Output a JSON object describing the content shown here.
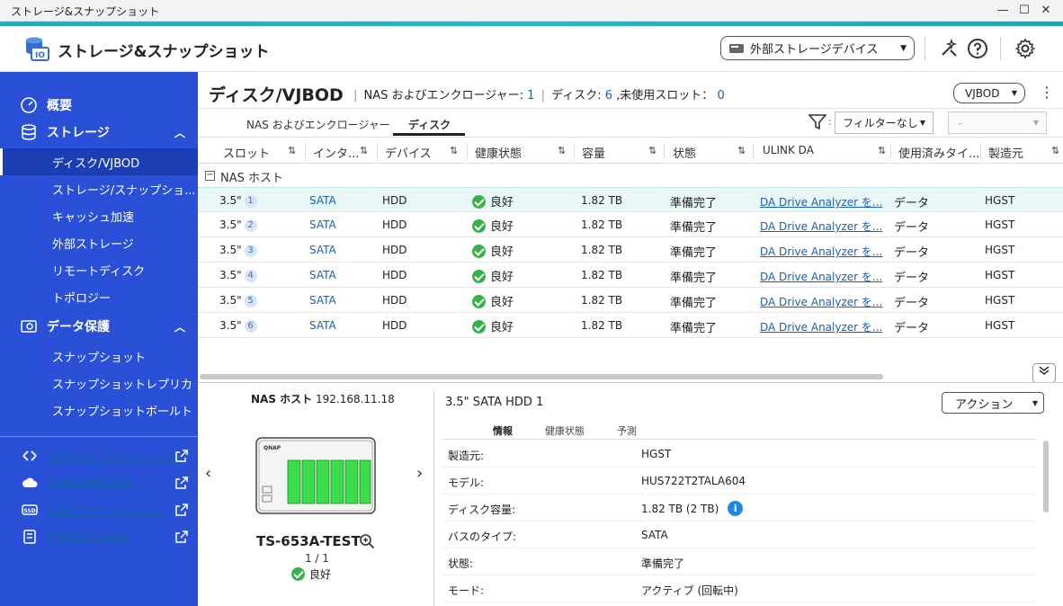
{
  "window": {
    "title": "ストレージ&スナップショット",
    "controls": [
      "—",
      "☐",
      "✕"
    ]
  },
  "app": {
    "title": "ストレージ&スナップショット",
    "external_device_label": "外部ストレージデバイス",
    "icons": [
      "wand-icon",
      "help-icon",
      "gear-icon"
    ]
  },
  "sidebar": {
    "overview": "概要",
    "storage": "ストレージ",
    "storage_items": [
      "ディスク/VJBOD",
      "ストレージ/スナップショ...",
      "キャッシュ加速",
      "外部ストレージ",
      "リモートディスク",
      "トポロジー"
    ],
    "protection": "データ保護",
    "protection_items": [
      "スナップショット",
      "スナップショットレプリカ",
      "スナップショットボールト"
    ],
    "links": [
      "iSCSI & ファイバーチ...",
      "HybridMount",
      "SSDプロファイリン...",
      "VJBOD Cloud"
    ]
  },
  "page": {
    "title": "ディスク/VJBOD",
    "sub_prefix": "NAS およびエンクロージャー:",
    "enclosures": "1",
    "disk_prefix": "ディスク:",
    "disks": "6",
    "slot_prefix": ",未使用スロット：",
    "unused_slots": "0",
    "vjbod_button": "VJBOD"
  },
  "tabs": [
    "NAS およびエンクロージャー",
    "ディスク"
  ],
  "filter": {
    "value": "フィルターなし",
    "second": "-"
  },
  "table": {
    "headers": [
      "スロット",
      "インタ...",
      "デバイス",
      "健康状態",
      "容量",
      "状態",
      "ULINK DA",
      "使用済みタイ...",
      "製造元"
    ],
    "group": "NAS ホスト",
    "rows": [
      {
        "slot": "3.5\"",
        "num": "1",
        "iface": "SATA",
        "device": "HDD",
        "health": "良好",
        "capacity": "1.82 TB",
        "status": "準備完了",
        "ulink": "DA Drive Analyzer を...",
        "used": "データ",
        "maker": "HGST"
      },
      {
        "slot": "3.5\"",
        "num": "2",
        "iface": "SATA",
        "device": "HDD",
        "health": "良好",
        "capacity": "1.82 TB",
        "status": "準備完了",
        "ulink": "DA Drive Analyzer を...",
        "used": "データ",
        "maker": "HGST"
      },
      {
        "slot": "3.5\"",
        "num": "3",
        "iface": "SATA",
        "device": "HDD",
        "health": "良好",
        "capacity": "1.82 TB",
        "status": "準備完了",
        "ulink": "DA Drive Analyzer を...",
        "used": "データ",
        "maker": "HGST"
      },
      {
        "slot": "3.5\"",
        "num": "4",
        "iface": "SATA",
        "device": "HDD",
        "health": "良好",
        "capacity": "1.82 TB",
        "status": "準備完了",
        "ulink": "DA Drive Analyzer を...",
        "used": "データ",
        "maker": "HGST"
      },
      {
        "slot": "3.5\"",
        "num": "5",
        "iface": "SATA",
        "device": "HDD",
        "health": "良好",
        "capacity": "1.82 TB",
        "status": "準備完了",
        "ulink": "DA Drive Analyzer を...",
        "used": "データ",
        "maker": "HGST"
      },
      {
        "slot": "3.5\"",
        "num": "6",
        "iface": "SATA",
        "device": "HDD",
        "health": "良好",
        "capacity": "1.82 TB",
        "status": "準備完了",
        "ulink": "DA Drive Analyzer を...",
        "used": "データ",
        "maker": "HGST"
      }
    ]
  },
  "device": {
    "host_label": "NAS ホスト",
    "ip": "192.168.11.18",
    "name": "TS-653A-TEST",
    "count": "1 / 1",
    "status": "良好"
  },
  "detail": {
    "title": "3.5\" SATA HDD 1",
    "action": "アクション",
    "tabs": [
      "情報",
      "健康状態",
      "予測"
    ],
    "props": [
      {
        "k": "製造元:",
        "v": "HGST"
      },
      {
        "k": "モデル:",
        "v": "HUS722T2TALA604"
      },
      {
        "k": "ディスク容量:",
        "v": "1.82 TB (2 TB)"
      },
      {
        "k": "バスのタイプ:",
        "v": "SATA"
      },
      {
        "k": "状態:",
        "v": "準備完了"
      },
      {
        "k": "モード:",
        "v": "アクティブ (回転中)"
      }
    ]
  }
}
